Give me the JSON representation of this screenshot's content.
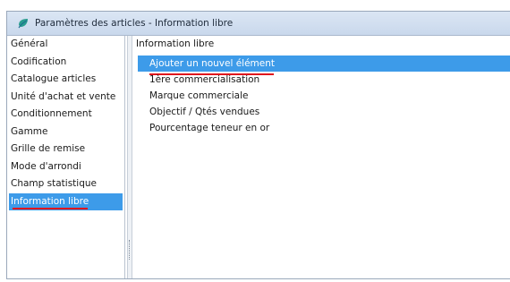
{
  "window": {
    "title": "Paramètres des articles - Information libre",
    "icon": "app-logo-icon"
  },
  "sidebar": {
    "items": [
      {
        "label": "Général"
      },
      {
        "label": "Codification"
      },
      {
        "label": "Catalogue articles"
      },
      {
        "label": "Unité d'achat et vente"
      },
      {
        "label": "Conditionnement"
      },
      {
        "label": "Gamme"
      },
      {
        "label": "Grille de remise"
      },
      {
        "label": "Mode d'arrondi"
      },
      {
        "label": "Champ statistique"
      },
      {
        "label": "Information libre",
        "selected": true
      }
    ]
  },
  "content": {
    "title": "Information libre",
    "items": [
      {
        "label": "Ajouter un nouvel élément",
        "selected": true
      },
      {
        "label": "1ère commercialisation"
      },
      {
        "label": "Marque commerciale"
      },
      {
        "label": "Objectif / Qtés vendues"
      },
      {
        "label": "Pourcentage teneur en or"
      }
    ]
  },
  "colors": {
    "selection": "#3d9be9",
    "annotation_underline": "#e0161d",
    "titlebar": "#c9d8ec"
  }
}
